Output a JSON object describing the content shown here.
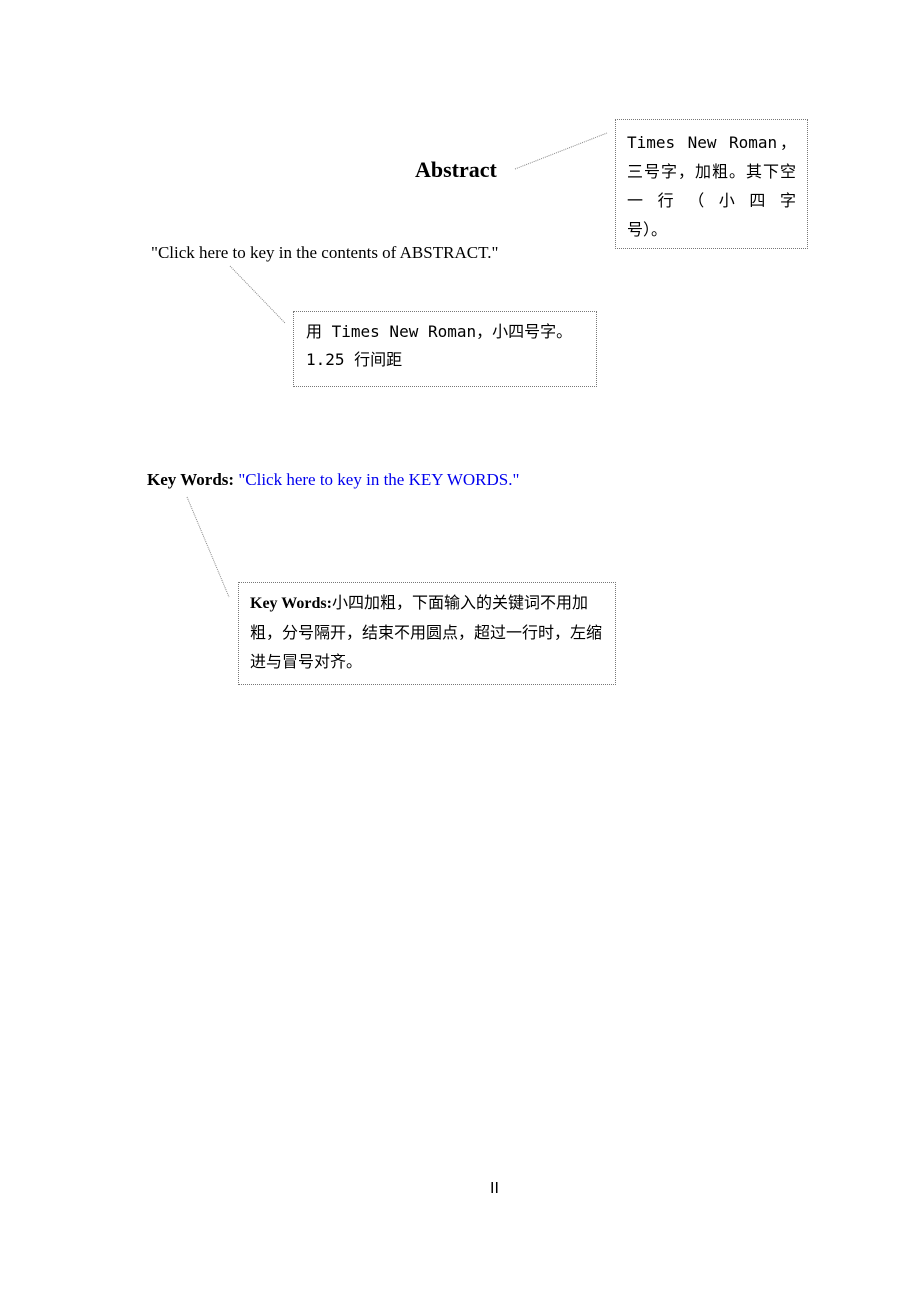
{
  "document": {
    "title": "Abstract",
    "abstract_placeholder": "\"Click here to key in the contents of ABSTRACT.\"",
    "keywords_label": "Key Words:",
    "keywords_placeholder": "\"Click here to key in the KEY WORDS.\"",
    "page_number": "II"
  },
  "callouts": {
    "title_note_line1": "Times New Roman，三号字，加粗。其下空一行（小四字",
    "title_note_line2": "号）。",
    "body_note_line1": "用 Times New Roman，小四号字。",
    "body_note_line2": "1.25 行间距",
    "keywords_note_label": "Key Words:",
    "keywords_note_text": "小四加粗，下面输入的关键词不用加粗，分号隔开，结束不用圆点，超过一行时，左缩进与冒号对齐。"
  },
  "colors": {
    "placeholder_blue": "#0000ee",
    "callout_border": "#777777"
  }
}
